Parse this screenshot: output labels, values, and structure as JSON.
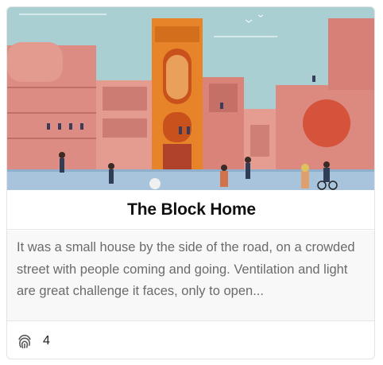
{
  "card": {
    "image_alt_icon": "illustration-building",
    "title": "The Block Home",
    "excerpt": "It was a small house by the side of the road, on a crowded street with people coming and going. Ventilation and light are great challenge it faces, only to open...",
    "footer": {
      "icon": "fingerprint-icon",
      "count": "4"
    }
  },
  "colors": {
    "sky": "#a9cfd3",
    "building_pink": "#d98a80",
    "tower_orange": "#e7842a",
    "ground": "#a8c3dc"
  }
}
